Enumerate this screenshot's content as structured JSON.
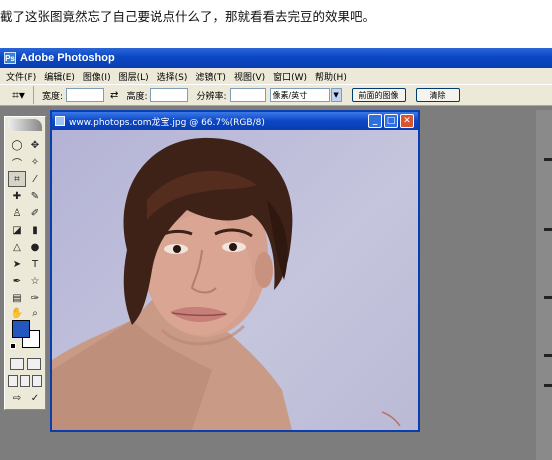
{
  "caption": "截了这张图竟然忘了自己要说点什么了，那就看看去完豆的效果吧。",
  "app": {
    "title": "Adobe Photoshop",
    "menu": [
      "文件(F)",
      "编辑(E)",
      "图像(I)",
      "图层(L)",
      "选择(S)",
      "滤镜(T)",
      "视图(V)",
      "窗口(W)",
      "帮助(H)"
    ]
  },
  "options": {
    "width_label": "宽度:",
    "height_label": "高度:",
    "resolution_label": "分辨率:",
    "units_value": "像素/英寸",
    "front_image_button": "前面的图像",
    "clear_button": "清除"
  },
  "document": {
    "title": "www.photops.com龙宝.jpg @ 66.7%(RGB/8)"
  },
  "colors": {
    "foreground": "#2456bf",
    "background": "#ffffff",
    "titlebar": "#0b47c4"
  }
}
